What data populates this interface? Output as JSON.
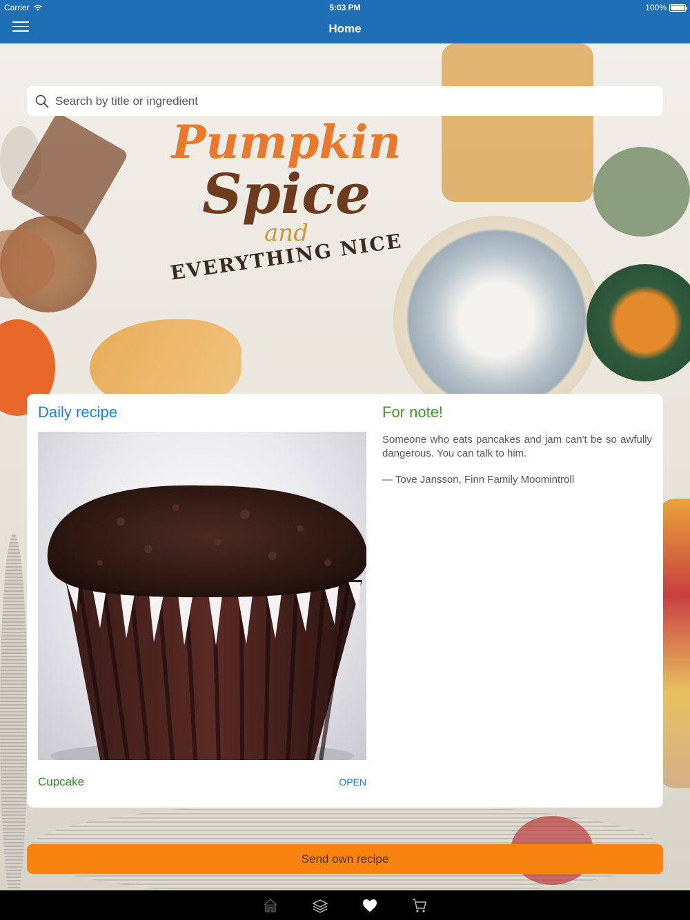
{
  "status_bar": {
    "carrier": "Carrier",
    "time": "5:03 PM",
    "battery": "100%"
  },
  "nav": {
    "title": "Home",
    "menu_icon": "hamburger-menu-icon"
  },
  "hero": {
    "line1": "Pumpkin",
    "line2": "Spice",
    "line3": "and",
    "line4": "EVERYTHING NICE"
  },
  "search": {
    "placeholder": "Search by title or ingredient",
    "value": "",
    "icon": "search-icon"
  },
  "daily_recipe": {
    "heading": "Daily recipe",
    "name": "Cupcake",
    "open_label": "OPEN"
  },
  "note": {
    "heading": "For note!",
    "quote": "Someone who eats pancakes and jam can't be so awfully dangerous. You can talk to him.",
    "author": "— Tove Jansson, Finn Family Moomintroll"
  },
  "send_button": {
    "label": "Send own recipe"
  },
  "tab_bar": {
    "tabs": [
      "home-icon",
      "layers-icon",
      "heart-icon",
      "cart-icon"
    ],
    "active": "heart-icon"
  },
  "colors": {
    "nav_bg": "#1f6fb6",
    "link_blue": "#1d7fd6",
    "note_green": "#3a9a24",
    "send_orange": "#f6840e"
  }
}
